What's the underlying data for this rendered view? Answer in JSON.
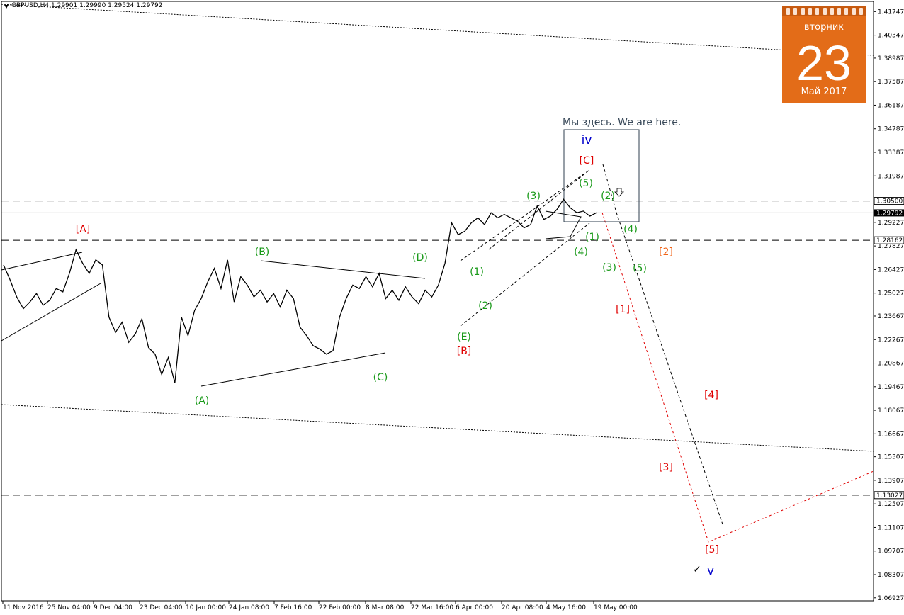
{
  "window": {
    "title": "GBPUSD,H4  1.29901 1.29990 1.29524 1.29792"
  },
  "calendar": {
    "weekday": "вторник",
    "day": "23",
    "month": "Май 2017"
  },
  "colors": {
    "green": "#1a9a1a",
    "red": "#e00000",
    "orange": "#f06418",
    "blue": "#0000cc",
    "price_line": "#000000",
    "calendar": "#e36c18"
  },
  "chart_data": {
    "type": "line",
    "symbol": "GBPUSD",
    "timeframe": "H4",
    "ohlc": {
      "open": 1.29901,
      "high": 1.2999,
      "low": 1.29524,
      "close": 1.29792
    },
    "ylim": [
      1.0675,
      1.4235
    ],
    "y_ticks": [
      "1.41747",
      "1.40347",
      "1.38987",
      "1.37587",
      "1.36187",
      "1.34787",
      "1.33387",
      "1.31987",
      "1.29227",
      "1.27827",
      "1.26427",
      "1.25027",
      "1.23667",
      "1.22267",
      "1.20867",
      "1.19467",
      "1.18067",
      "1.16667",
      "1.15307",
      "1.13907",
      "1.12507",
      "1.11107",
      "1.09707",
      "1.08307",
      "1.06927"
    ],
    "price_labels": [
      {
        "value": 1.305,
        "text": "1.30500",
        "style": "level"
      },
      {
        "value": 1.29792,
        "text": "1.29792",
        "style": "current"
      },
      {
        "value": 1.28162,
        "text": "1.28162",
        "style": "level"
      },
      {
        "value": 1.13027,
        "text": "1.13027",
        "style": "level"
      }
    ],
    "x_labels": [
      "11 Nov 2016",
      "25 Nov 04:00",
      "9 Dec 04:00",
      "23 Dec 04:00",
      "10 Jan 00:00",
      "24 Jan 08:00",
      "7 Feb 16:00",
      "22 Feb 00:00",
      "8 Mar 08:00",
      "22 Mar 16:00",
      "6 Apr 00:00",
      "20 Apr 08:00",
      "4 May 16:00",
      "19 May 00:00"
    ],
    "price_series": {
      "name": "GBPUSD",
      "x": [
        0,
        1,
        2,
        3,
        4,
        5,
        6,
        7,
        8,
        9,
        10,
        11,
        12,
        13,
        14,
        15,
        16,
        17,
        18,
        19,
        20,
        21,
        22,
        23,
        24,
        25,
        26,
        27,
        28,
        29,
        30,
        31,
        32,
        33,
        34,
        35,
        36,
        37,
        38,
        39,
        40,
        41,
        42,
        43,
        44,
        45,
        46,
        47,
        48,
        49,
        50,
        51,
        52,
        53,
        54,
        55,
        56,
        57,
        58,
        59,
        60,
        61,
        62,
        63,
        64,
        65,
        66,
        67,
        68,
        69,
        70,
        71,
        72,
        73,
        74,
        75,
        76,
        77,
        78,
        79,
        80,
        81,
        82,
        83,
        84,
        85,
        86,
        87,
        88,
        89,
        90
      ],
      "y": [
        1.267,
        1.258,
        1.248,
        1.241,
        1.245,
        1.25,
        1.243,
        1.246,
        1.253,
        1.251,
        1.262,
        1.276,
        1.268,
        1.262,
        1.27,
        1.267,
        1.236,
        1.227,
        1.233,
        1.221,
        1.226,
        1.235,
        1.218,
        1.214,
        1.202,
        1.212,
        1.197,
        1.236,
        1.225,
        1.24,
        1.247,
        1.257,
        1.265,
        1.253,
        1.27,
        1.245,
        1.26,
        1.255,
        1.248,
        1.252,
        1.245,
        1.25,
        1.242,
        1.252,
        1.247,
        1.23,
        1.225,
        1.219,
        1.217,
        1.214,
        1.216,
        1.236,
        1.247,
        1.255,
        1.253,
        1.26,
        1.254,
        1.262,
        1.247,
        1.252,
        1.246,
        1.254,
        1.248,
        1.244,
        1.252,
        1.248,
        1.255,
        1.268,
        1.292,
        1.285,
        1.287,
        1.292,
        1.295,
        1.291,
        1.298,
        1.295,
        1.297,
        1.295,
        1.293,
        1.289,
        1.291,
        1.302,
        1.294,
        1.296,
        1.3,
        1.306,
        1.301,
        1.298,
        1.299,
        1.296,
        1.298
      ]
    },
    "wave_labels": [
      {
        "text": "[A]",
        "color": "red",
        "price": 1.2905
      },
      {
        "text": "(A)",
        "color": "green",
        "price": 1.1805
      },
      {
        "text": "(B)",
        "color": "green",
        "price": 1.2783
      },
      {
        "text": "(C)",
        "color": "green",
        "price": 1.2005
      },
      {
        "text": "(D)",
        "color": "green",
        "price": 1.2695
      },
      {
        "text": "(E)",
        "color": "green",
        "price": 1.2287
      },
      {
        "text": "[B]",
        "color": "red",
        "price": 1.2215
      },
      {
        "text": "(1)",
        "color": "green",
        "price": 1.2555
      },
      {
        "text": "(2)",
        "color": "green",
        "price": 1.2405
      },
      {
        "text": "(3)",
        "color": "green",
        "price": 1.3087
      },
      {
        "text": "(4)",
        "color": "green",
        "price": 1.2777
      },
      {
        "text": "(5)",
        "color": "green",
        "price": 1.3147
      },
      {
        "text": "[C]",
        "color": "red",
        "price": 1.3367
      },
      {
        "text": "iv",
        "color": "blue",
        "price": 1.3467
      },
      {
        "text": "(1)",
        "color": "green",
        "price": 1.2865
      },
      {
        "text": "(2)",
        "color": "green",
        "price": 1.3092
      },
      {
        "text": "(3)",
        "color": "green",
        "price": 1.2625
      },
      {
        "text": "(4)",
        "color": "green",
        "price": 1.2925
      },
      {
        "text": "(5)",
        "color": "green",
        "price": 1.2625
      },
      {
        "text": "[1]",
        "color": "red",
        "price": 1.2413
      },
      {
        "text": "[2]",
        "color": "orange",
        "price": 1.2775
      },
      {
        "text": "[3]",
        "color": "red",
        "price": 1.1435
      },
      {
        "text": "[4]",
        "color": "red",
        "price": 1.1945
      },
      {
        "text": "[5]",
        "color": "red",
        "price": 1.0985
      },
      {
        "text": "v",
        "color": "blue",
        "price": 1.0875
      }
    ],
    "annotation": "Мы здесь. We are here."
  }
}
